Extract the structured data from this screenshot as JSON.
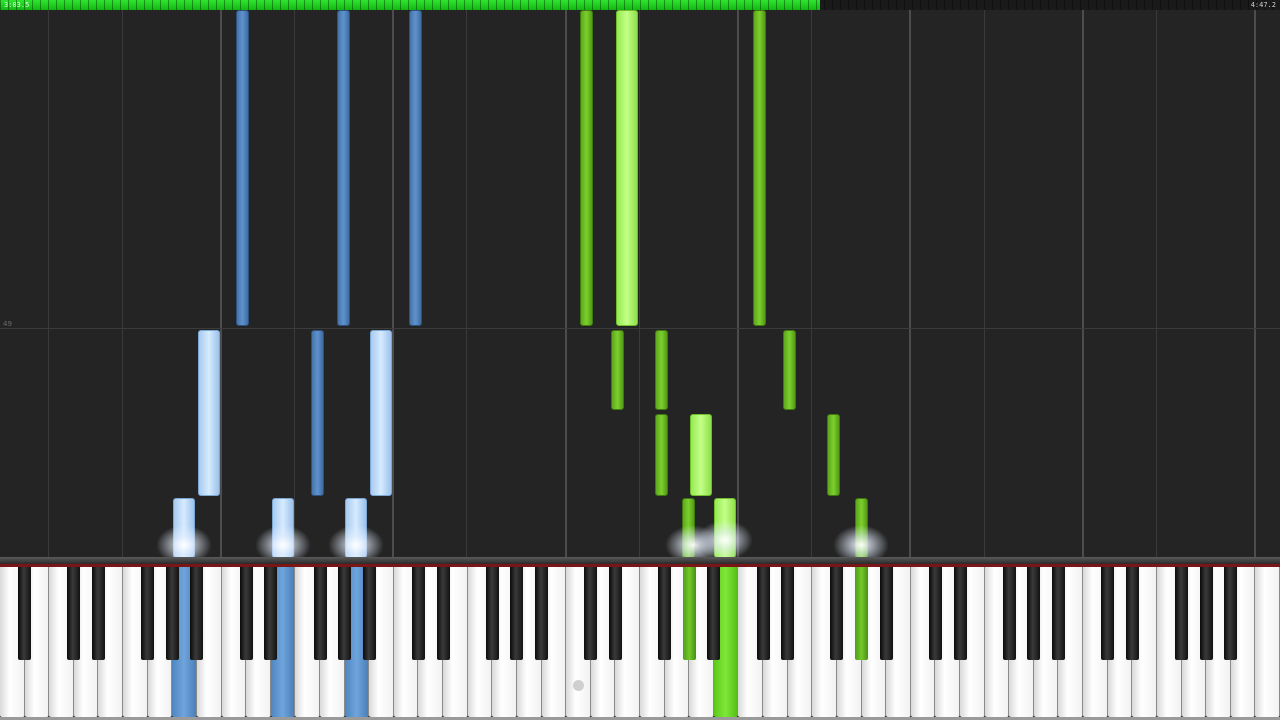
{
  "playback": {
    "current_time": "3:03.5",
    "total_time": "4:47.2",
    "progress_percent": 64.1
  },
  "roll": {
    "measure_number": "49"
  },
  "colors": {
    "background": "#242424",
    "left_hand": "#5f92cf",
    "right_hand": "#7cd02c",
    "progress": "#22d022"
  },
  "keyboard": {
    "middle_c_marker": "circle-dot-icon"
  }
}
